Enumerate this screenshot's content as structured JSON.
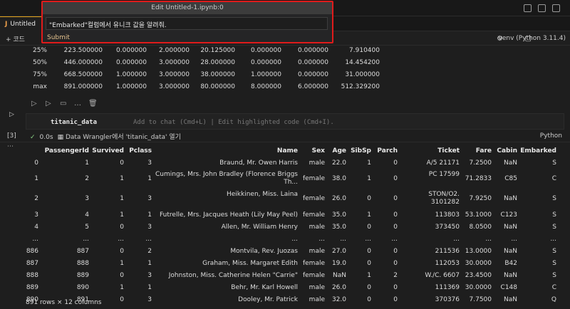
{
  "chat": {
    "title": "Edit Untitled-1.ipynb:0",
    "input": "\"Embarked\"컬럼에서 유니크 값을 알려줘.",
    "submit": "Submit"
  },
  "tabs": [
    {
      "label": "Untitled"
    }
  ],
  "toolbar": {
    "add_code": "+ 코드",
    "kernel": "venv (Python 3.11.4)"
  },
  "describe": {
    "rows": [
      {
        "stat": "25%",
        "values": [
          "223.500000",
          "0.000000",
          "2.000000",
          "20.125000",
          "0.000000",
          "0.000000",
          "7.910400"
        ]
      },
      {
        "stat": "50%",
        "values": [
          "446.000000",
          "0.000000",
          "3.000000",
          "28.000000",
          "0.000000",
          "0.000000",
          "14.454200"
        ]
      },
      {
        "stat": "75%",
        "values": [
          "668.500000",
          "1.000000",
          "3.000000",
          "38.000000",
          "1.000000",
          "0.000000",
          "31.000000"
        ]
      },
      {
        "stat": "max",
        "values": [
          "891.000000",
          "1.000000",
          "3.000000",
          "80.000000",
          "8.000000",
          "6.000000",
          "512.329200"
        ]
      }
    ]
  },
  "cell": {
    "code": "titanic_data",
    "hint": "Add to chat (Cmd+L) | Edit highlighted code (Cmd+I).",
    "exec_count": "[3]",
    "time": "0.0s",
    "wrangler": "Data Wrangler에서 'titanic_data' 열기",
    "language": "Python"
  },
  "dataframe": {
    "columns": [
      "",
      "PassengerId",
      "Survived",
      "Pclass",
      "Name",
      "Sex",
      "Age",
      "SibSp",
      "Parch",
      "Ticket",
      "Fare",
      "Cabin",
      "Embarked"
    ],
    "rows": [
      [
        "0",
        "1",
        "0",
        "3",
        "Braund, Mr. Owen Harris",
        "male",
        "22.0",
        "1",
        "0",
        "A/5 21171",
        "7.2500",
        "NaN",
        "S"
      ],
      [
        "1",
        "2",
        "1",
        "1",
        "Cumings, Mrs. John Bradley (Florence Briggs Th...",
        "female",
        "38.0",
        "1",
        "0",
        "PC 17599",
        "71.2833",
        "C85",
        "C"
      ],
      [
        "2",
        "3",
        "1",
        "3",
        "Heikkinen, Miss. Laina",
        "female",
        "26.0",
        "0",
        "0",
        "STON/O2. 3101282",
        "7.9250",
        "NaN",
        "S"
      ],
      [
        "3",
        "4",
        "1",
        "1",
        "Futrelle, Mrs. Jacques Heath (Lily May Peel)",
        "female",
        "35.0",
        "1",
        "0",
        "113803",
        "53.1000",
        "C123",
        "S"
      ],
      [
        "4",
        "5",
        "0",
        "3",
        "Allen, Mr. William Henry",
        "male",
        "35.0",
        "0",
        "0",
        "373450",
        "8.0500",
        "NaN",
        "S"
      ],
      [
        "...",
        "...",
        "...",
        "...",
        "...",
        "...",
        "...",
        "...",
        "...",
        "...",
        "...",
        "...",
        "..."
      ],
      [
        "886",
        "887",
        "0",
        "2",
        "Montvila, Rev. Juozas",
        "male",
        "27.0",
        "0",
        "0",
        "211536",
        "13.0000",
        "NaN",
        "S"
      ],
      [
        "887",
        "888",
        "1",
        "1",
        "Graham, Miss. Margaret Edith",
        "female",
        "19.0",
        "0",
        "0",
        "112053",
        "30.0000",
        "B42",
        "S"
      ],
      [
        "888",
        "889",
        "0",
        "3",
        "Johnston, Miss. Catherine Helen \"Carrie\"",
        "female",
        "NaN",
        "1",
        "2",
        "W./C. 6607",
        "23.4500",
        "NaN",
        "S"
      ],
      [
        "889",
        "890",
        "1",
        "1",
        "Behr, Mr. Karl Howell",
        "male",
        "26.0",
        "0",
        "0",
        "111369",
        "30.0000",
        "C148",
        "C"
      ],
      [
        "890",
        "891",
        "0",
        "3",
        "Dooley, Mr. Patrick",
        "male",
        "32.0",
        "0",
        "0",
        "370376",
        "7.7500",
        "NaN",
        "Q"
      ]
    ],
    "shape": "891 rows × 12 columns"
  }
}
